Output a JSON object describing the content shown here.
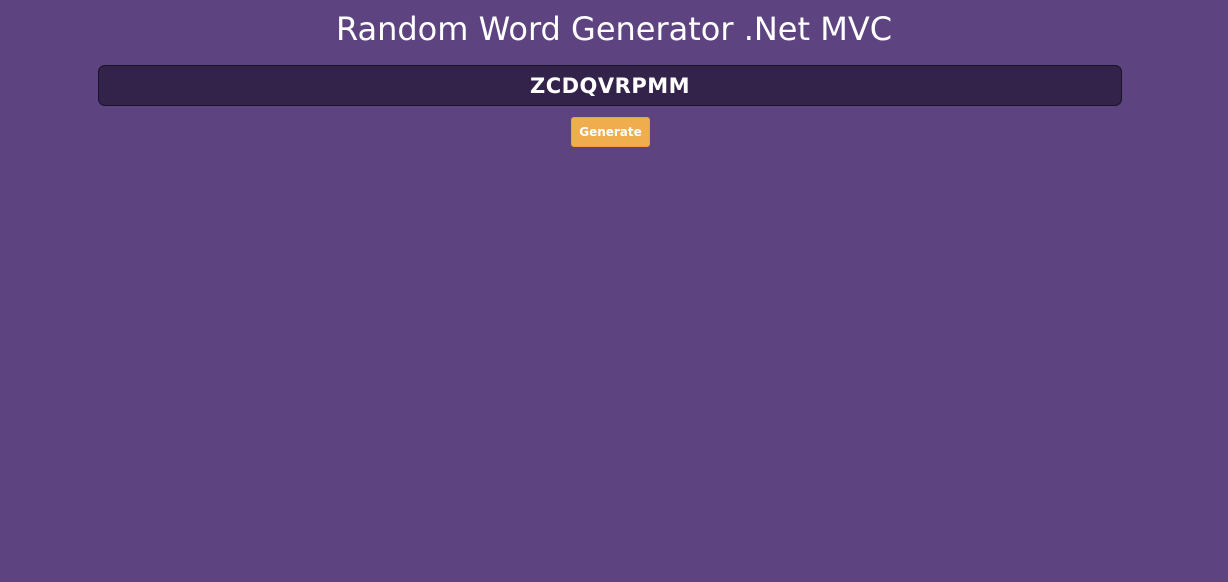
{
  "page": {
    "title": "Random Word Generator .Net MVC"
  },
  "word_display": {
    "value": "ZCDQVRPMM"
  },
  "actions": {
    "generate_label": "Generate"
  },
  "colors": {
    "background": "#5d4481",
    "display_box": "#33234b",
    "button": "#f0ad4e",
    "text": "#ffffff"
  }
}
